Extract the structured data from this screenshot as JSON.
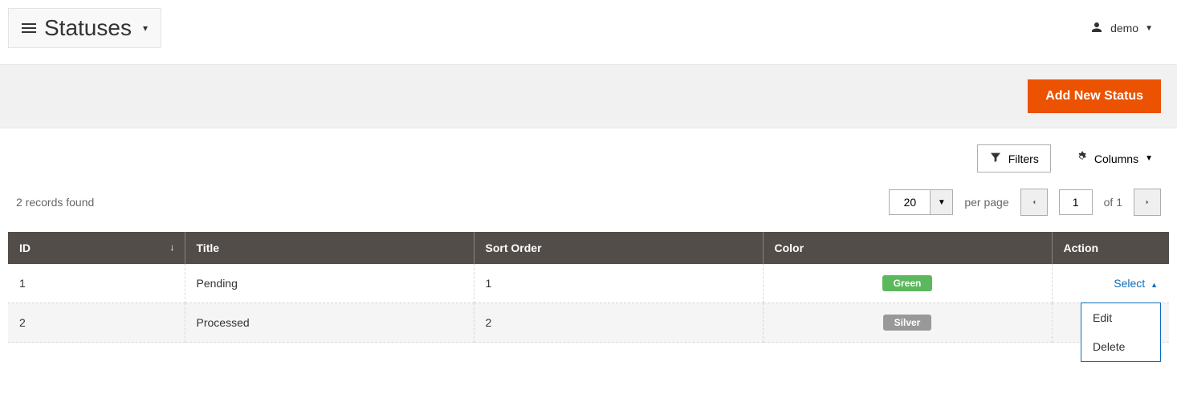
{
  "header": {
    "title": "Statuses",
    "user": "demo"
  },
  "actionBar": {
    "addButton": "Add New Status"
  },
  "toolbar": {
    "filters": "Filters",
    "columns": "Columns"
  },
  "pagination": {
    "recordsFound": "2 records found",
    "pageSize": "20",
    "perPage": "per page",
    "currentPage": "1",
    "ofLabel": "of 1"
  },
  "table": {
    "headers": {
      "id": "ID",
      "title": "Title",
      "sortOrder": "Sort Order",
      "color": "Color",
      "action": "Action"
    },
    "rows": [
      {
        "id": "1",
        "title": "Pending",
        "sortOrder": "1",
        "color": "Green",
        "colorClass": "green"
      },
      {
        "id": "2",
        "title": "Processed",
        "sortOrder": "2",
        "color": "Silver",
        "colorClass": "silver"
      }
    ],
    "actionLabel": "Select",
    "dropdown": {
      "edit": "Edit",
      "delete": "Delete"
    }
  }
}
